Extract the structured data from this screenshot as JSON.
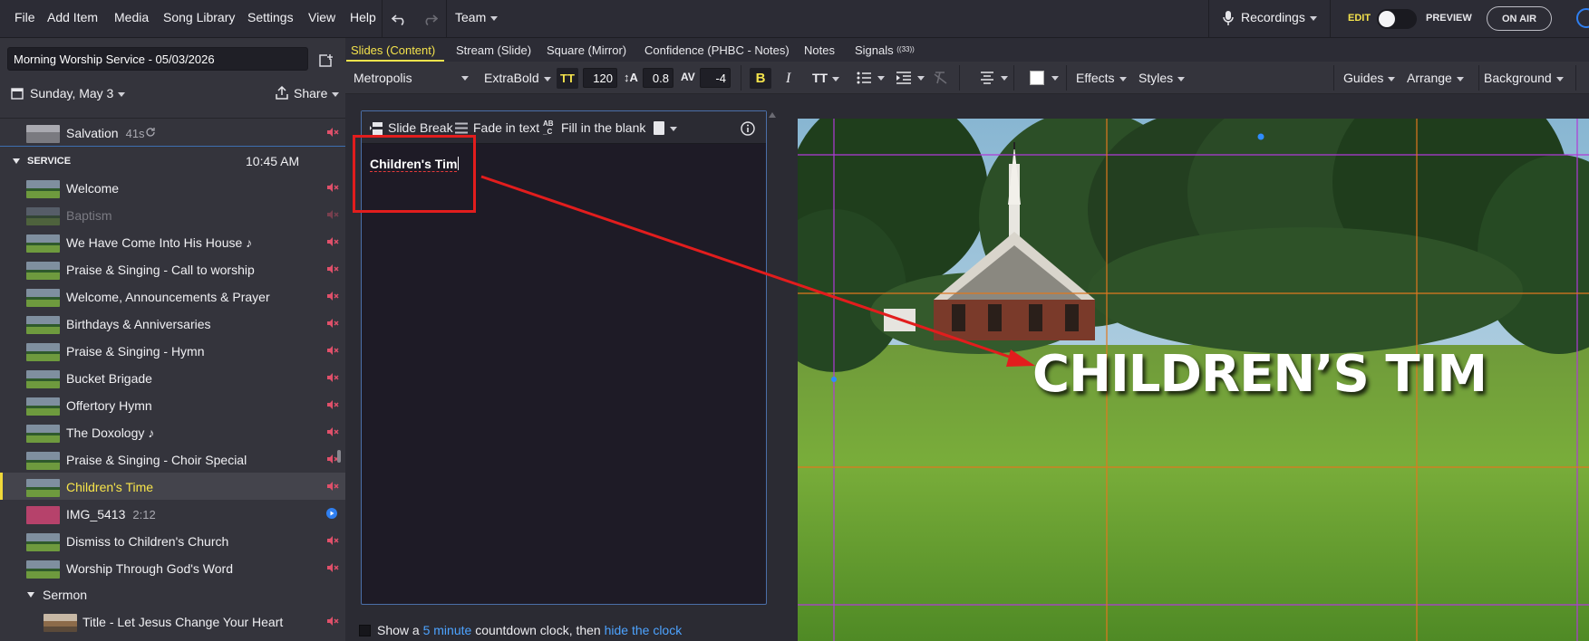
{
  "menu": {
    "items": [
      "File",
      "Add Item",
      "Media",
      "Song Library",
      "Settings",
      "View",
      "Help"
    ],
    "team": "Team",
    "recordings": "Recordings",
    "edit": "EDIT",
    "preview": "PREVIEW",
    "on_air": "ON AIR"
  },
  "sidebar": {
    "service_title": "Morning Worship Service - 05/03/2026",
    "date": "Sunday, May 3",
    "share": "Share",
    "pre_item": {
      "label": "Salvation",
      "duration": "41s"
    },
    "section": {
      "label": "SERVICE",
      "time": "10:45 AM"
    },
    "items": [
      {
        "label": "Welcome"
      },
      {
        "label": "Baptism"
      },
      {
        "label": "We Have Come Into His House",
        "note": "♪"
      },
      {
        "label": "Praise & Singing - Call to worship"
      },
      {
        "label": "Welcome, Announcements & Prayer"
      },
      {
        "label": "Birthdays & Anniversaries"
      },
      {
        "label": "Praise & Singing - Hymn"
      },
      {
        "label": "Bucket Brigade"
      },
      {
        "label": "Offertory Hymn"
      },
      {
        "label": "The Doxology",
        "note": "♪"
      },
      {
        "label": "Praise & Singing - Choir Special"
      },
      {
        "label": "Children's Time"
      },
      {
        "label": "IMG_5413",
        "duration": "2:12"
      },
      {
        "label": "Dismiss to Children's Church"
      },
      {
        "label": "Worship Through God's Word"
      }
    ],
    "sermon_group": "Sermon",
    "sermon_items": [
      {
        "label": "Title - Let Jesus Change Your Heart"
      }
    ]
  },
  "tabs": {
    "items": [
      "Slides (Content)",
      "Stream (Slide)",
      "Square (Mirror)",
      "Confidence (PHBC - Notes)",
      "Notes"
    ],
    "signals": "Signals",
    "signals_badge": "((33))"
  },
  "toolbar": {
    "font": "Metropolis",
    "weight": "ExtraBold",
    "size": "120",
    "line_height": "0.8",
    "tracking": "-4",
    "bold": "B",
    "italic": "I",
    "effects": "Effects",
    "styles": "Styles",
    "guides": "Guides",
    "arrange": "Arrange",
    "background": "Background"
  },
  "editor": {
    "slide_break": "Slide Break",
    "fade_in": "Fade in text",
    "fill_blank": "Fill in the blank",
    "text": "Children's Tim"
  },
  "countdown": {
    "prefix": "Show a",
    "minutes": "5 minute",
    "middle": "countdown clock, then",
    "action": "hide the clock"
  },
  "slide": {
    "title": "CHILDREN’S TIM"
  },
  "colors": {
    "accent_yellow": "#f4e34c",
    "mute_red": "#e0506a",
    "link_blue": "#4da3ff",
    "annotation_red": "#e21d1d"
  }
}
